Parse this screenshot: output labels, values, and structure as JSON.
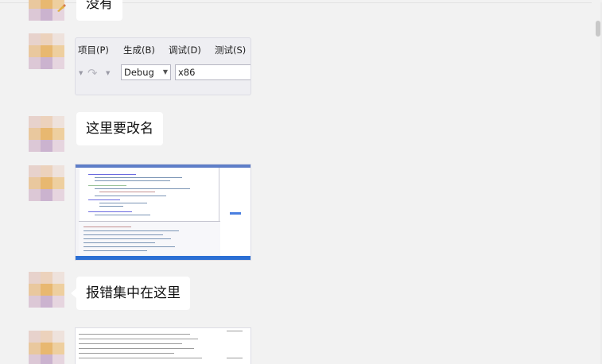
{
  "messages": [
    {
      "type": "text",
      "text": "没有"
    },
    {
      "type": "image",
      "content": {
        "menus": [
          "项目(P)",
          "生成(B)",
          "调试(D)",
          "测试(S)"
        ],
        "config_value": "Debug",
        "platform_value": "x86"
      }
    },
    {
      "type": "text",
      "text": "这里要改名"
    },
    {
      "type": "image",
      "content": "ide-screenshot"
    },
    {
      "type": "text",
      "text": "报错集中在这里"
    },
    {
      "type": "image",
      "content": "error-text-screenshot"
    }
  ]
}
